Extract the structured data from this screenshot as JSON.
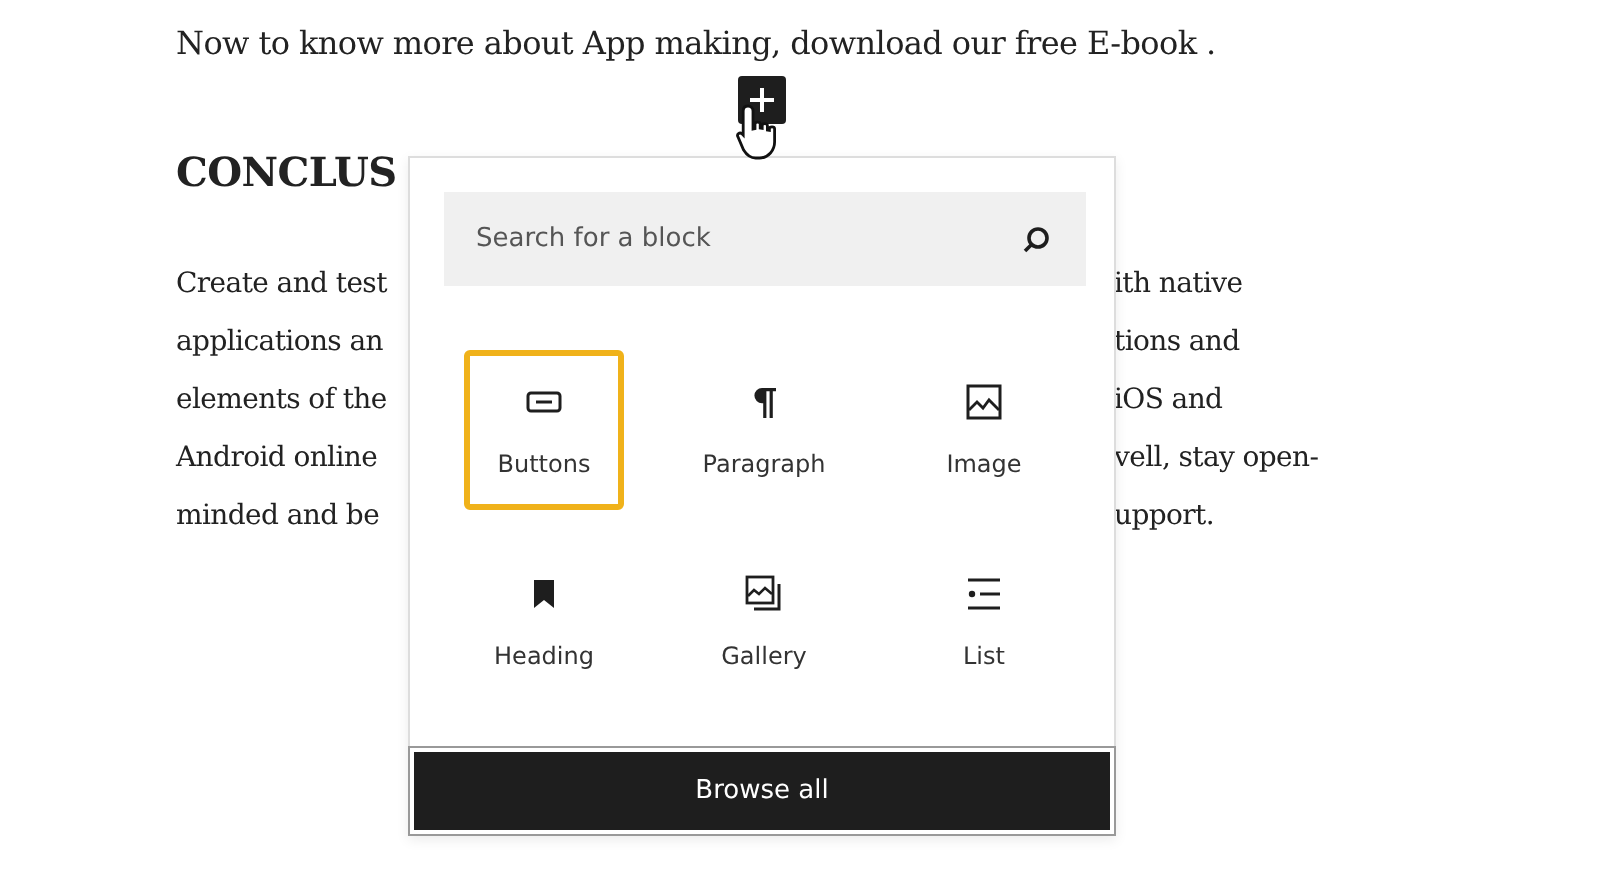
{
  "intro": "Now to know more about App making, download our free E-book .",
  "heading": "CONCLUS",
  "paragraph_lines": [
    {
      "left": "Create and test",
      "right": "ith native"
    },
    {
      "left": "applications an",
      "right": "tions and"
    },
    {
      "left": "elements of the",
      "right": "iOS and"
    },
    {
      "left": "Android online",
      "right": "vell, stay open-"
    },
    {
      "left": "minded and be",
      "right": "upport."
    }
  ],
  "inserter": {
    "search": {
      "placeholder": "Search for a block"
    },
    "blocks": [
      {
        "kind": "buttons",
        "label": "Buttons",
        "selected": true
      },
      {
        "kind": "paragraph",
        "label": "Paragraph",
        "selected": false
      },
      {
        "kind": "image",
        "label": "Image",
        "selected": false
      },
      {
        "kind": "heading",
        "label": "Heading",
        "selected": false
      },
      {
        "kind": "gallery",
        "label": "Gallery",
        "selected": false
      },
      {
        "kind": "list",
        "label": "List",
        "selected": false
      }
    ],
    "browse_button": "Browse all"
  }
}
